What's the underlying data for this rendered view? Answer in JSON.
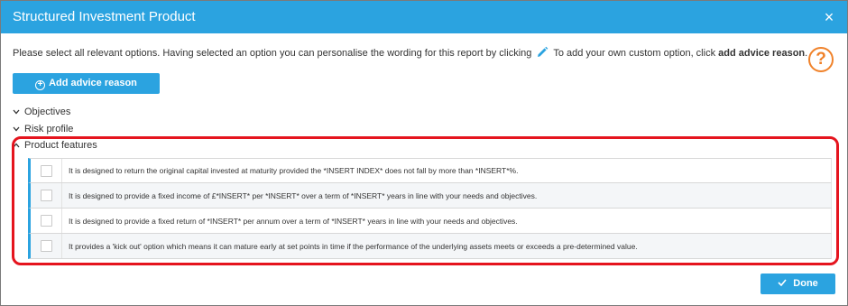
{
  "dialog": {
    "title": "Structured Investment Product",
    "close_glyph": "×"
  },
  "instructions": {
    "part1": "Please select all relevant options. Having selected an option you can personalise the wording for this report by clicking",
    "part2": "To add your own custom option, click",
    "bold": "add advice reason",
    "end": ".",
    "pencil_icon": "pencil-icon"
  },
  "help": {
    "glyph": "?",
    "icon": "help-circle-icon",
    "color": "#f0822a"
  },
  "add_reason_button": {
    "label": "Add advice reason",
    "icon": "plus-circle-icon"
  },
  "sections": [
    {
      "label": "Objectives",
      "expanded": false
    },
    {
      "label": "Risk profile",
      "expanded": false
    },
    {
      "label": "Product features",
      "expanded": true
    }
  ],
  "product_features": [
    {
      "text": "It is designed to return the original capital invested at maturity provided the *INSERT INDEX* does not fall by more than *INSERT*%.",
      "checked": false
    },
    {
      "text": "It is designed to provide a fixed income of £*INSERT* per *INSERT* over a term of *INSERT* years in line with your needs and objectives.",
      "checked": false
    },
    {
      "text": "It is designed to provide a fixed return of *INSERT* per annum over a term of *INSERT* years in line with your needs and objectives.",
      "checked": false
    },
    {
      "text": "It provides a 'kick out' option which means it can mature early at set points in time if the performance of the underlying assets meets or exceeds a pre-determined value.",
      "checked": false
    }
  ],
  "done_button": {
    "label": "Done",
    "icon": "check-icon"
  },
  "colors": {
    "accent": "#2ba3e0",
    "highlight": "#e5141e"
  }
}
